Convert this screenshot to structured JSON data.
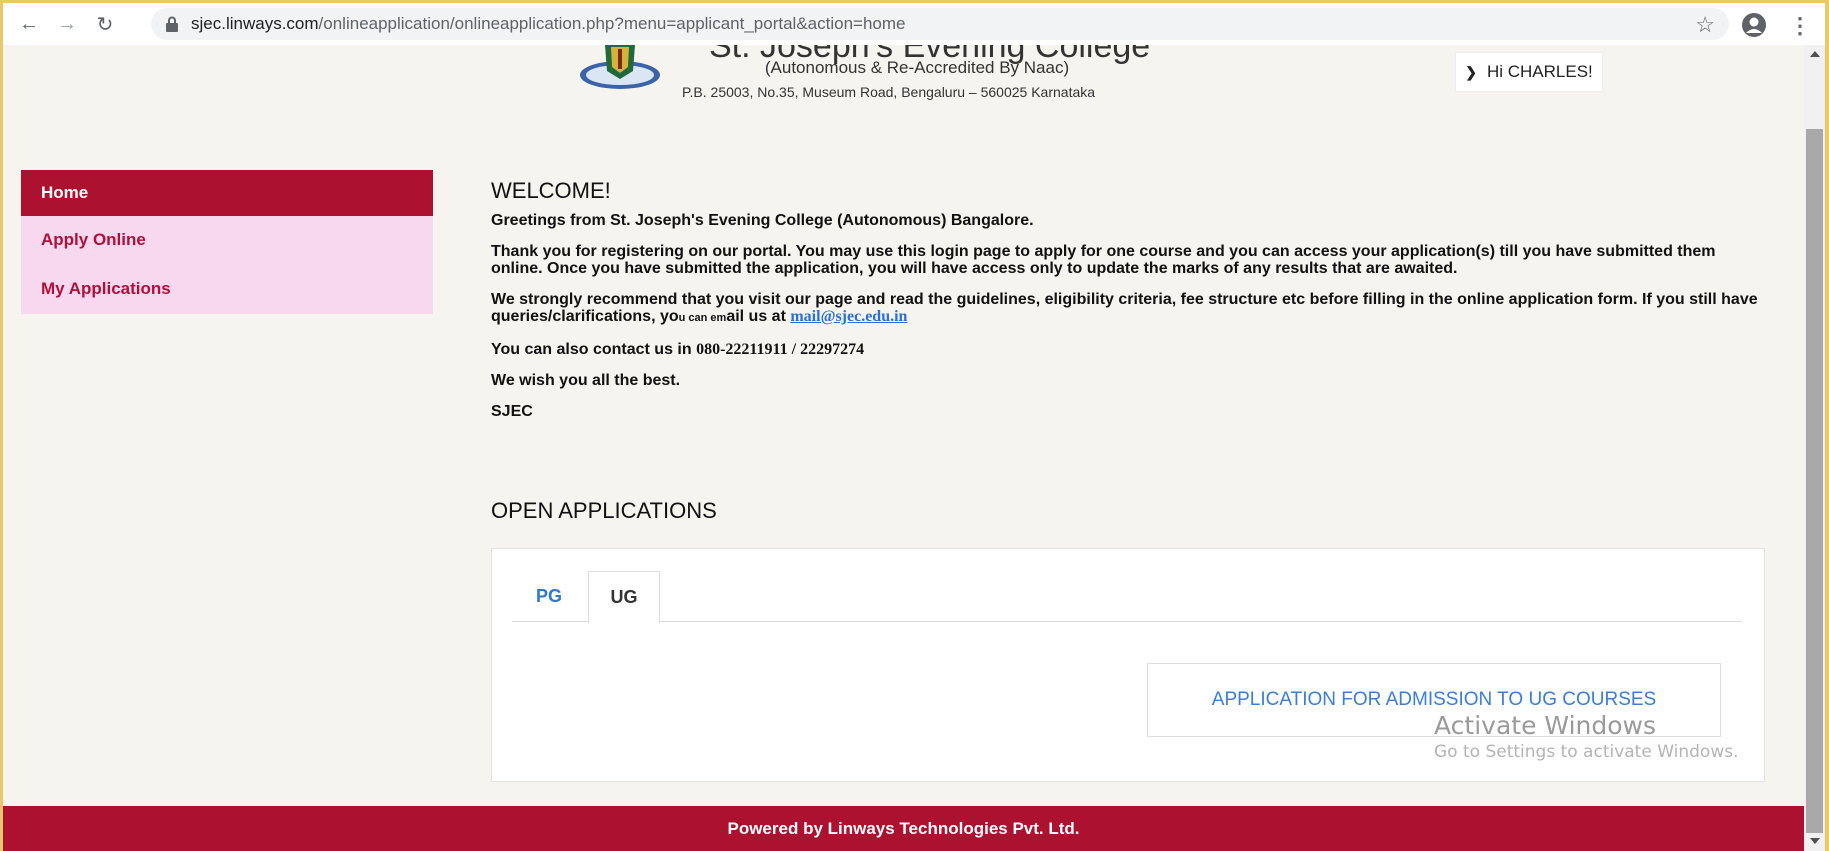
{
  "browser": {
    "url_domain": "sjec.linways.com",
    "url_path": "/onlineapplication/onlineapplication.php?menu=applicant_portal&action=home"
  },
  "header": {
    "college_name": "St. Joseph's Evening College",
    "subtitle": "(Autonomous & Re-Accredited By Naac)",
    "address": "P.B. 25003, No.35, Museum Road, Bengaluru – 560025 Karnataka",
    "user_greeting": "Hi CHARLES!"
  },
  "sidebar": {
    "items": [
      {
        "label": "Home"
      },
      {
        "label": "Apply Online"
      },
      {
        "label": "My Applications"
      }
    ]
  },
  "welcome": {
    "title": "WELCOME!",
    "greeting": "Greetings from St. Joseph's Evening College (Autonomous) Bangalore.",
    "para1": "Thank you for registering on our portal. You may use this login page to apply for one course and you can access your application(s) till you have submitted them online. Once you have submitted the application, you will have access only to update the marks of any results that are awaited.",
    "para2_a": "We strongly recommend that you visit our page and read the guidelines, eligibility criteria, fee structure etc before filling in the online application form. If you still have queries/clarifications, yo",
    "para2_small": "u can em",
    "para2_b": "ail us at ",
    "email": "mail@sjec.edu.in",
    "contact_prefix": "You can also contact us in ",
    "phone": "080-22211911 / 22297274",
    "wish": "We wish you all the best.",
    "signoff": "SJEC"
  },
  "open_applications": {
    "title": "OPEN APPLICATIONS",
    "tabs": [
      {
        "label": "PG"
      },
      {
        "label": "UG"
      }
    ],
    "active_tab": "UG",
    "application_link": "APPLICATION FOR ADMISSION TO UG COURSES"
  },
  "watermark": {
    "title": "Activate Windows",
    "subtitle": "Go to Settings to activate Windows."
  },
  "footer": {
    "text": "Powered by Linways Technologies Pvt. Ltd."
  },
  "colors": {
    "accent": "#ac1130",
    "sidebar_bg": "#f8d8ee",
    "link": "#3b7dd8",
    "page_bg": "#f6f4ef"
  }
}
